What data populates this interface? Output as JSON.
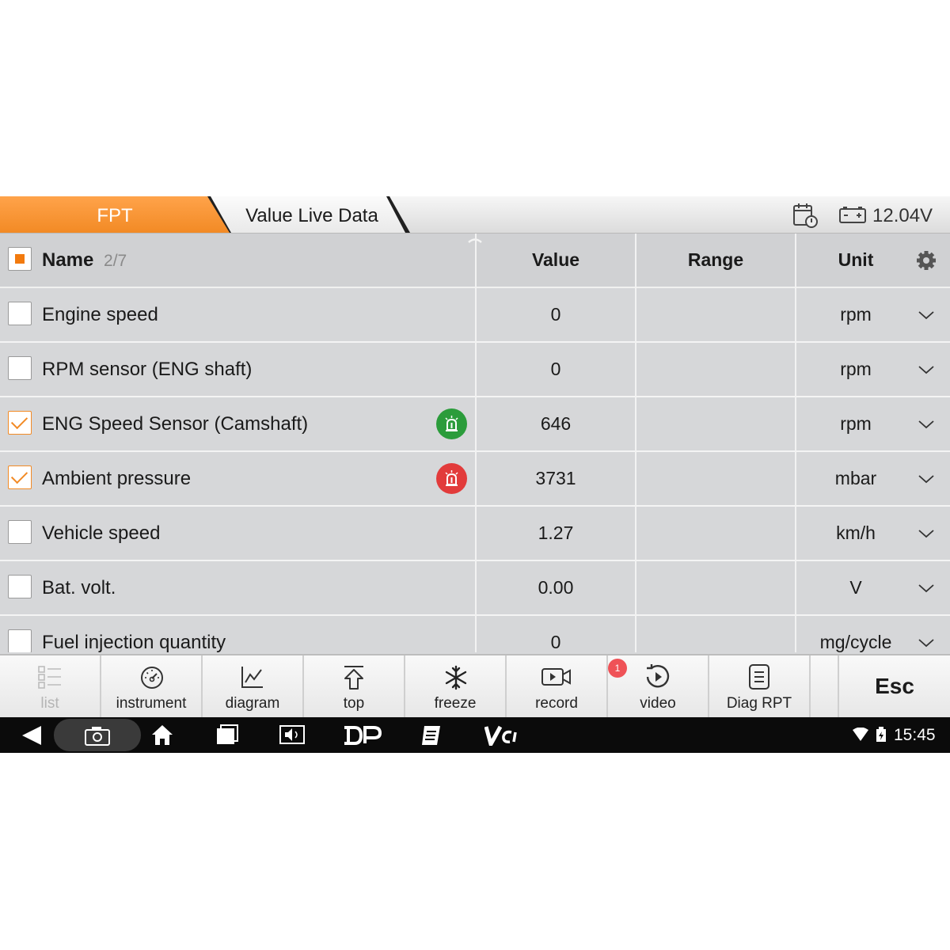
{
  "title_bar": {
    "tab_primary": "FPT",
    "tab_secondary": "Value Live Data",
    "voltage": "12.04V",
    "icons": [
      "calendar-clock-icon",
      "battery-icon"
    ]
  },
  "table": {
    "header": {
      "name_label": "Name",
      "page_indicator": "2/7",
      "value_label": "Value",
      "range_label": "Range",
      "unit_label": "Unit"
    },
    "rows": [
      {
        "name": "Engine speed",
        "value": "0",
        "range": "",
        "unit": "rpm",
        "checked": false,
        "alarm": null
      },
      {
        "name": "RPM sensor (ENG shaft)",
        "value": "0",
        "range": "",
        "unit": "rpm",
        "checked": false,
        "alarm": null
      },
      {
        "name": "ENG Speed Sensor (Camshaft)",
        "value": "646",
        "range": "",
        "unit": "rpm",
        "checked": true,
        "alarm": "green"
      },
      {
        "name": "Ambient pressure",
        "value": "3731",
        "range": "",
        "unit": "mbar",
        "checked": true,
        "alarm": "red"
      },
      {
        "name": "Vehicle speed",
        "value": "1.27",
        "range": "",
        "unit": "km/h",
        "checked": false,
        "alarm": null
      },
      {
        "name": "Bat. volt.",
        "value": "0.00",
        "range": "",
        "unit": "V",
        "checked": false,
        "alarm": null
      },
      {
        "name": "Fuel injection quantity",
        "value": "0",
        "range": "",
        "unit": "mg/cycle",
        "checked": false,
        "alarm": null
      }
    ]
  },
  "toolbar": {
    "list": "list",
    "instrument": "instrument",
    "diagram": "diagram",
    "top": "top",
    "freeze": "freeze",
    "record": "record",
    "video": "video",
    "video_badge": "1",
    "diag_rpt": "Diag RPT",
    "esc": "Esc"
  },
  "status_bar": {
    "time": "15:45"
  },
  "colors": {
    "accent": "#f28a25",
    "alarm_green": "#2b9c3b",
    "alarm_red": "#e23b3b",
    "row_bg": "#d6d7d9"
  }
}
